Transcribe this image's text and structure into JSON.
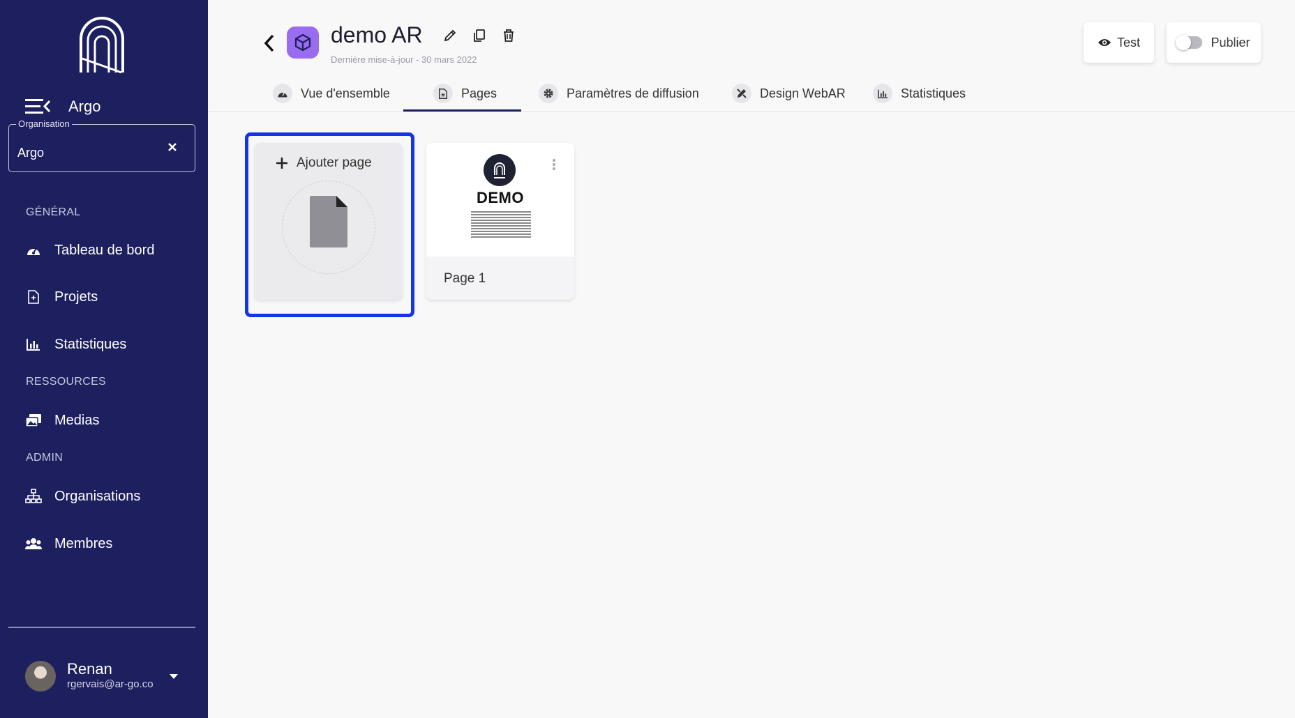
{
  "sidebar": {
    "app_name": "Argo",
    "organisation": {
      "legend": "Organisation",
      "value": "Argo"
    },
    "sections": {
      "general": "GÉNÉRAL",
      "resources": "RESSOURCES",
      "admin": "ADMIN"
    },
    "items": [
      {
        "label": "Tableau de bord",
        "icon": "dashboard-icon"
      },
      {
        "label": "Projets",
        "icon": "document-icon"
      },
      {
        "label": "Statistiques",
        "icon": "bar-chart-icon"
      },
      {
        "label": "Medias",
        "icon": "media-icon"
      },
      {
        "label": "Organisations",
        "icon": "org-tree-icon"
      },
      {
        "label": "Membres",
        "icon": "members-icon"
      }
    ],
    "user": {
      "name": "Renan",
      "email": "rgervais@ar-go.co"
    }
  },
  "header": {
    "title": "demo AR",
    "subtitle": "Dernière mise-à-jour - 30 mars 2022",
    "test_label": "Test",
    "publish_label": "Publier",
    "publish_on": false
  },
  "tabs": [
    {
      "label": "Vue d'ensemble",
      "icon": "dashboard-icon"
    },
    {
      "label": "Pages",
      "icon": "document-icon",
      "active": true
    },
    {
      "label": "Paramètres de diffusion",
      "icon": "gear-icon"
    },
    {
      "label": "Design WebAR",
      "icon": "pencil-ruler-icon"
    },
    {
      "label": "Statistiques",
      "icon": "bar-chart-icon"
    }
  ],
  "cards": {
    "add_label": "Ajouter page",
    "pages": [
      {
        "label": "Page 1",
        "thumb_title": "DEMO"
      }
    ]
  },
  "colors": {
    "sidebar": "#1d1f5e",
    "accent": "#9a6cf0",
    "highlight": "#1534e6"
  }
}
